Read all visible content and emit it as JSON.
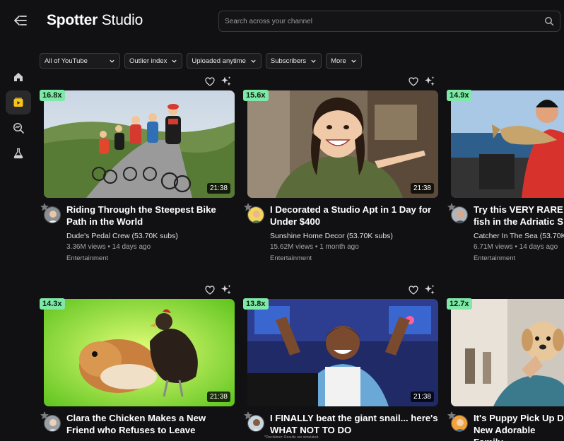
{
  "header": {
    "brand_primary": "Spotter",
    "brand_secondary": "Studio",
    "search_placeholder": "Search across your channel"
  },
  "filters": [
    {
      "label": "All of YouTube"
    },
    {
      "label": "Outlier index"
    },
    {
      "label": "Uploaded anytime"
    },
    {
      "label": "Subscribers"
    },
    {
      "label": "More"
    }
  ],
  "sidebar": {
    "items": [
      {
        "icon": "home-icon"
      },
      {
        "icon": "video-icon",
        "active": true
      },
      {
        "icon": "analytics-search-icon"
      },
      {
        "icon": "lab-flask-icon"
      }
    ]
  },
  "videos": [
    {
      "outlier": "16.8x",
      "duration": "21:38",
      "title": "Riding Through the Steepest Bike Path in the World",
      "channel": "Dude's Pedal Crew",
      "subs": "(53.70K subs)",
      "views": "3.36M views",
      "age": "14 days ago",
      "category": "Entertainment"
    },
    {
      "outlier": "15.6x",
      "duration": "21:38",
      "title": "I Decorated a Studio Apt in 1 Day for Under $400",
      "channel": "Sunshine Home Decor",
      "subs": "(53.70K subs)",
      "views": "15.62M views",
      "age": "1 month ago",
      "category": "Entertainment"
    },
    {
      "outlier": "14.9x",
      "duration": "21:38",
      "title": "Try this VERY RARE fish in the Adriatic S",
      "channel": "Catcher In The Sea",
      "subs": "(53.70K",
      "views": "6.71M views",
      "age": "14 days ago",
      "category": "Entertainment"
    },
    {
      "outlier": "14.3x",
      "duration": "21:38",
      "title": "Clara the Chicken Makes a New Friend who Refuses to Leave",
      "channel": "",
      "subs": "",
      "views": "",
      "age": "",
      "category": ""
    },
    {
      "outlier": "13.8x",
      "duration": "21:38",
      "title": "I FINALLY beat the giant snail... here's WHAT NOT TO DO",
      "channel": "",
      "subs": "",
      "views": "",
      "age": "",
      "category": ""
    },
    {
      "outlier": "12.7x",
      "duration": "21:38",
      "title": "It's Puppy Pick Up D New Adorable Family",
      "channel": "",
      "subs": "",
      "views": "",
      "age": "",
      "category": ""
    }
  ],
  "footer": {
    "disclaimer": "*Disclaimer: Results are simulated."
  },
  "colors": {
    "background": "#111113",
    "badge": "#7ee8a6",
    "chip_border": "#3c3c40"
  }
}
